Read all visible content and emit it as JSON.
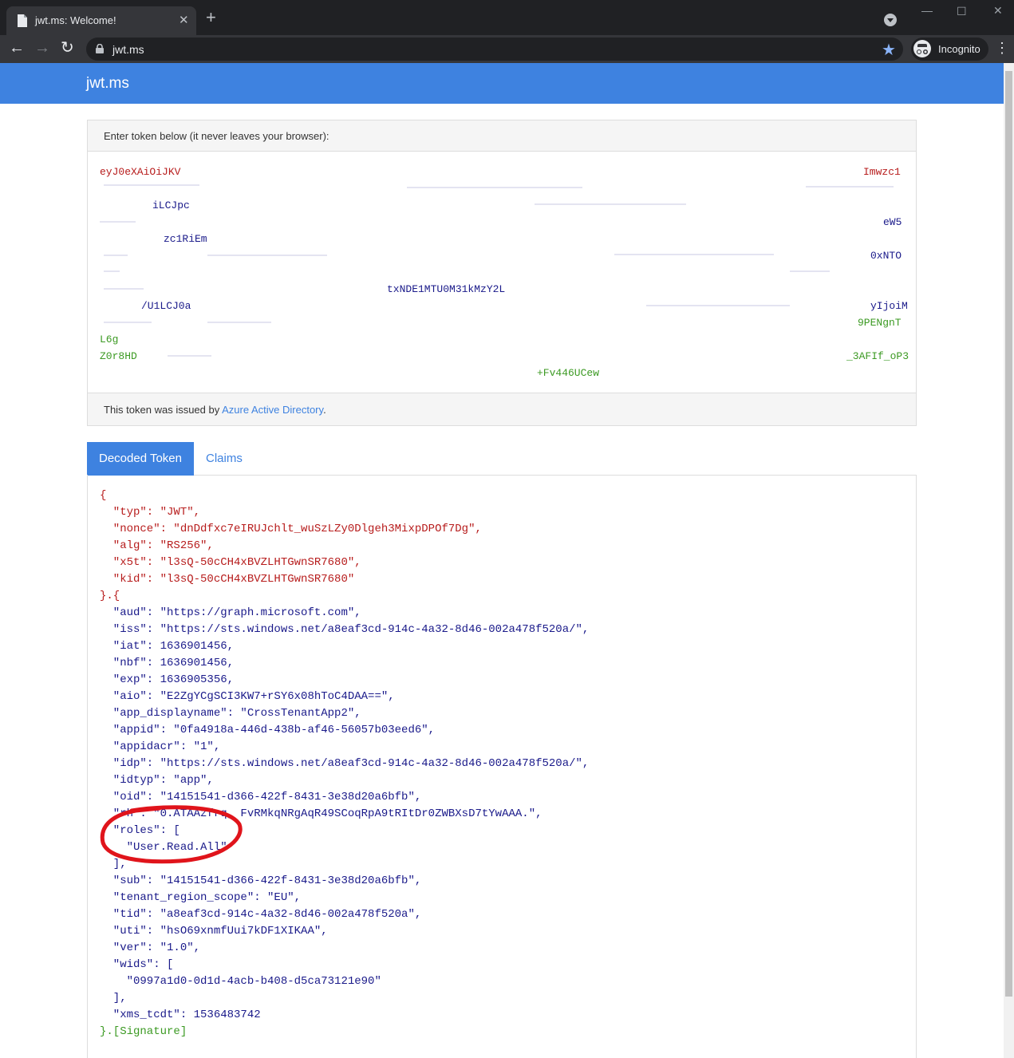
{
  "browser": {
    "tab_title": "jwt.ms: Welcome!",
    "url": "jwt.ms",
    "profile_label": "Incognito"
  },
  "page": {
    "brand": "jwt.ms",
    "enter_label": "Enter token below (it never leaves your browser):",
    "issued_prefix": "This token was issued by ",
    "issuer_link": "Azure Active Directory",
    "issued_suffix": ".",
    "tabs": [
      "Decoded Token",
      "Claims"
    ]
  },
  "token_fragments": {
    "red": [
      {
        "t": "eyJ0eXAiOiJKV",
        "l": 0
      },
      {
        "t": "Imwzc1",
        "l": 957
      }
    ],
    "blue": [
      {
        "t": "iLCJpc",
        "l": 66
      },
      {
        "t": "zc1RiEm",
        "l": 80
      },
      {
        "t": "eW5",
        "l": 982
      },
      {
        "t": "0xNTO",
        "l": 966
      },
      {
        "t": "txNDE1MTU0M31kMzY2L",
        "l": 360
      },
      {
        "t": "yIjoiM",
        "l": 966
      },
      {
        "t": "/U1LCJ0a",
        "l": 52
      }
    ],
    "green": [
      {
        "t": "L6g",
        "l": 0
      },
      {
        "t": "9PENgnT",
        "l": 950
      },
      {
        "t": "Z0r8HD",
        "l": 0
      },
      {
        "t": "_3AFIf_oP3",
        "l": 936
      },
      {
        "t": "+Fv446UCew",
        "l": 548
      }
    ]
  },
  "decoded": {
    "header_lines": [
      "{",
      "  \"typ\": \"JWT\",",
      "  \"nonce\": \"dnDdfxc7eIRUJchlt_wuSzLZy0Dlgeh3MixpDPOf7Dg\",",
      "  \"alg\": \"RS256\",",
      "  \"x5t\": \"l3sQ-50cCH4xBVZLHTGwnSR7680\",",
      "  \"kid\": \"l3sQ-50cCH4xBVZLHTGwnSR7680\""
    ],
    "separator": "}.{",
    "payload_lines": [
      "  \"aud\": \"https://graph.microsoft.com\",",
      "  \"iss\": \"https://sts.windows.net/a8eaf3cd-914c-4a32-8d46-002a478f520a/\",",
      "  \"iat\": 1636901456,",
      "  \"nbf\": 1636901456,",
      "  \"exp\": 1636905356,",
      "  \"aio\": \"E2ZgYCgSCI3KW7+rSY6x08hToC4DAA==\",",
      "  \"app_displayname\": \"CrossTenantApp2\",",
      "  \"appid\": \"0fa4918a-446d-438b-af46-56057b03eed6\",",
      "  \"appidacr\": \"1\",",
      "  \"idp\": \"https://sts.windows.net/a8eaf3cd-914c-4a32-8d46-002a478f520a/\",",
      "  \"idtyp\": \"app\",",
      "  \"oid\": \"14151541-d366-422f-8431-3e38d20a6bfb\",",
      "  \"rh\": \"0.ATAAzfrq, FvRMkqNRgAqR49SCoqRpA9tRItDr0ZWBXsD7tYwAAA.\",",
      "  \"roles\": [",
      "    \"User.Read.All\"",
      "  ],",
      "  \"sub\": \"14151541-d366-422f-8431-3e38d20a6bfb\",",
      "  \"tenant_region_scope\": \"EU\",",
      "  \"tid\": \"a8eaf3cd-914c-4a32-8d46-002a478f520a\",",
      "  \"uti\": \"hsO69xnmfUui7kDF1XIKAA\",",
      "  \"ver\": \"1.0\",",
      "  \"wids\": [",
      "    \"0997a1d0-0d1d-4acb-b408-d5ca73121e90\"",
      "  ],",
      "  \"xms_tcdt\": 1536483742"
    ],
    "signature": "}.[Signature]"
  },
  "colors": {
    "accent": "#3e82e0",
    "header_json": "#b71c1c",
    "payload_json": "#1a1a8a",
    "signature": "#3c9a23",
    "annotation": "#e0141b"
  }
}
